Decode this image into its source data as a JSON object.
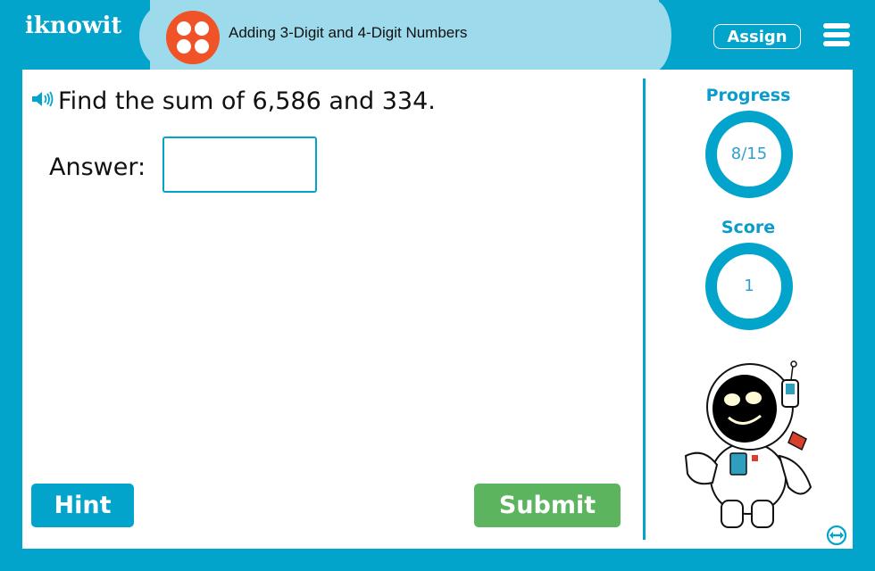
{
  "header": {
    "logo": "iknowit",
    "topic_title": "Adding 3-Digit and 4-Digit Numbers",
    "assign_label": "Assign",
    "menu_icon": "hamburger-menu-icon",
    "topic_icon": "four-dots-icon"
  },
  "question": {
    "speaker_icon": "speaker-icon",
    "text": "Find the sum of 6,586 and 334.",
    "answer_label": "Answer:",
    "answer_value": "",
    "answer_placeholder": ""
  },
  "buttons": {
    "hint": "Hint",
    "submit": "Submit"
  },
  "sidebar": {
    "progress_label": "Progress",
    "progress_value": "8/15",
    "progress_current": 8,
    "progress_total": 15,
    "score_label": "Score",
    "score_value": "1",
    "mascot": "astronaut",
    "resize_icon": "resize-horizontal-icon"
  },
  "colors": {
    "brand_blue": "#03a4cb",
    "light_blue": "#9ddbec",
    "topic_orange": "#ef5327",
    "submit_green": "#5cb45e"
  }
}
